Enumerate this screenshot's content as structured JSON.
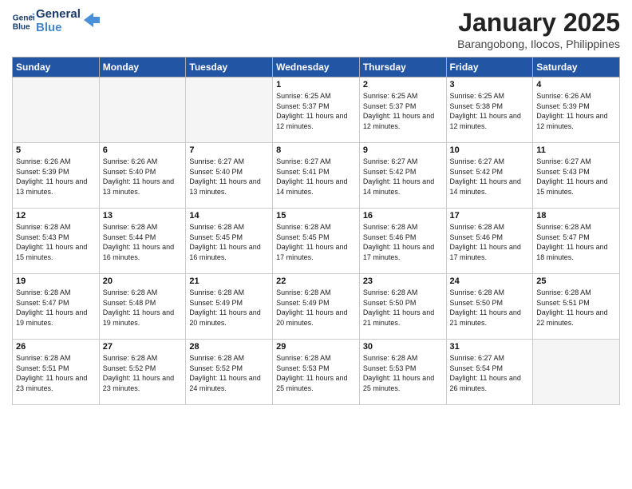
{
  "logo": {
    "line1": "General",
    "line2": "Blue"
  },
  "title": "January 2025",
  "subtitle": "Barangobong, Ilocos, Philippines",
  "weekdays": [
    "Sunday",
    "Monday",
    "Tuesday",
    "Wednesday",
    "Thursday",
    "Friday",
    "Saturday"
  ],
  "weeks": [
    [
      {
        "day": "",
        "info": ""
      },
      {
        "day": "",
        "info": ""
      },
      {
        "day": "",
        "info": ""
      },
      {
        "day": "1",
        "info": "Sunrise: 6:25 AM\nSunset: 5:37 PM\nDaylight: 11 hours and 12 minutes."
      },
      {
        "day": "2",
        "info": "Sunrise: 6:25 AM\nSunset: 5:37 PM\nDaylight: 11 hours and 12 minutes."
      },
      {
        "day": "3",
        "info": "Sunrise: 6:25 AM\nSunset: 5:38 PM\nDaylight: 11 hours and 12 minutes."
      },
      {
        "day": "4",
        "info": "Sunrise: 6:26 AM\nSunset: 5:39 PM\nDaylight: 11 hours and 12 minutes."
      }
    ],
    [
      {
        "day": "5",
        "info": "Sunrise: 6:26 AM\nSunset: 5:39 PM\nDaylight: 11 hours and 13 minutes."
      },
      {
        "day": "6",
        "info": "Sunrise: 6:26 AM\nSunset: 5:40 PM\nDaylight: 11 hours and 13 minutes."
      },
      {
        "day": "7",
        "info": "Sunrise: 6:27 AM\nSunset: 5:40 PM\nDaylight: 11 hours and 13 minutes."
      },
      {
        "day": "8",
        "info": "Sunrise: 6:27 AM\nSunset: 5:41 PM\nDaylight: 11 hours and 14 minutes."
      },
      {
        "day": "9",
        "info": "Sunrise: 6:27 AM\nSunset: 5:42 PM\nDaylight: 11 hours and 14 minutes."
      },
      {
        "day": "10",
        "info": "Sunrise: 6:27 AM\nSunset: 5:42 PM\nDaylight: 11 hours and 14 minutes."
      },
      {
        "day": "11",
        "info": "Sunrise: 6:27 AM\nSunset: 5:43 PM\nDaylight: 11 hours and 15 minutes."
      }
    ],
    [
      {
        "day": "12",
        "info": "Sunrise: 6:28 AM\nSunset: 5:43 PM\nDaylight: 11 hours and 15 minutes."
      },
      {
        "day": "13",
        "info": "Sunrise: 6:28 AM\nSunset: 5:44 PM\nDaylight: 11 hours and 16 minutes."
      },
      {
        "day": "14",
        "info": "Sunrise: 6:28 AM\nSunset: 5:45 PM\nDaylight: 11 hours and 16 minutes."
      },
      {
        "day": "15",
        "info": "Sunrise: 6:28 AM\nSunset: 5:45 PM\nDaylight: 11 hours and 17 minutes."
      },
      {
        "day": "16",
        "info": "Sunrise: 6:28 AM\nSunset: 5:46 PM\nDaylight: 11 hours and 17 minutes."
      },
      {
        "day": "17",
        "info": "Sunrise: 6:28 AM\nSunset: 5:46 PM\nDaylight: 11 hours and 17 minutes."
      },
      {
        "day": "18",
        "info": "Sunrise: 6:28 AM\nSunset: 5:47 PM\nDaylight: 11 hours and 18 minutes."
      }
    ],
    [
      {
        "day": "19",
        "info": "Sunrise: 6:28 AM\nSunset: 5:47 PM\nDaylight: 11 hours and 19 minutes."
      },
      {
        "day": "20",
        "info": "Sunrise: 6:28 AM\nSunset: 5:48 PM\nDaylight: 11 hours and 19 minutes."
      },
      {
        "day": "21",
        "info": "Sunrise: 6:28 AM\nSunset: 5:49 PM\nDaylight: 11 hours and 20 minutes."
      },
      {
        "day": "22",
        "info": "Sunrise: 6:28 AM\nSunset: 5:49 PM\nDaylight: 11 hours and 20 minutes."
      },
      {
        "day": "23",
        "info": "Sunrise: 6:28 AM\nSunset: 5:50 PM\nDaylight: 11 hours and 21 minutes."
      },
      {
        "day": "24",
        "info": "Sunrise: 6:28 AM\nSunset: 5:50 PM\nDaylight: 11 hours and 21 minutes."
      },
      {
        "day": "25",
        "info": "Sunrise: 6:28 AM\nSunset: 5:51 PM\nDaylight: 11 hours and 22 minutes."
      }
    ],
    [
      {
        "day": "26",
        "info": "Sunrise: 6:28 AM\nSunset: 5:51 PM\nDaylight: 11 hours and 23 minutes."
      },
      {
        "day": "27",
        "info": "Sunrise: 6:28 AM\nSunset: 5:52 PM\nDaylight: 11 hours and 23 minutes."
      },
      {
        "day": "28",
        "info": "Sunrise: 6:28 AM\nSunset: 5:52 PM\nDaylight: 11 hours and 24 minutes."
      },
      {
        "day": "29",
        "info": "Sunrise: 6:28 AM\nSunset: 5:53 PM\nDaylight: 11 hours and 25 minutes."
      },
      {
        "day": "30",
        "info": "Sunrise: 6:28 AM\nSunset: 5:53 PM\nDaylight: 11 hours and 25 minutes."
      },
      {
        "day": "31",
        "info": "Sunrise: 6:27 AM\nSunset: 5:54 PM\nDaylight: 11 hours and 26 minutes."
      },
      {
        "day": "",
        "info": ""
      }
    ]
  ]
}
